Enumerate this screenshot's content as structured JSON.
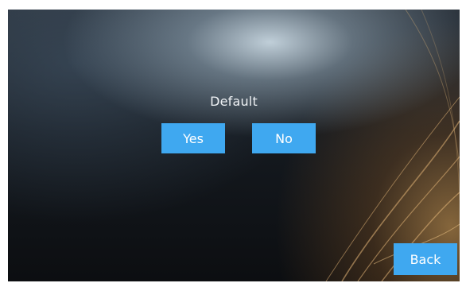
{
  "dialog": {
    "title": "Default",
    "yes_label": "Yes",
    "no_label": "No"
  },
  "footer": {
    "back_label": "Back"
  },
  "colors": {
    "button_bg": "#3fa8f0",
    "button_text": "#ffffff",
    "title_text": "#eef1f4"
  }
}
